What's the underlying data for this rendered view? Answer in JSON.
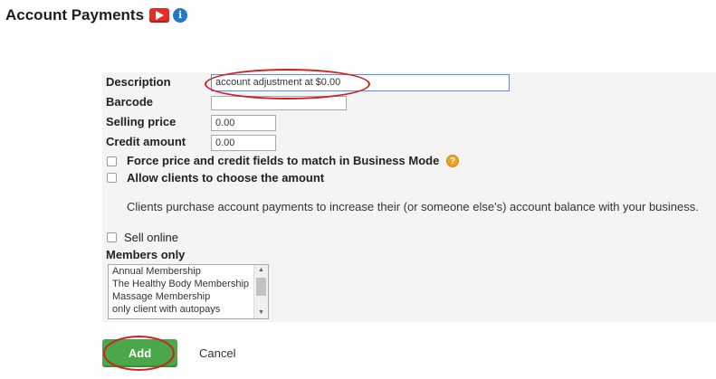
{
  "header": {
    "title": "Account Payments",
    "video_icon": "youtube-play-icon",
    "info_icon": "info-icon",
    "info_glyph": "i"
  },
  "form": {
    "description_label": "Description",
    "description_value": "account adjustment at $0.00",
    "barcode_label": "Barcode",
    "barcode_value": "",
    "selling_price_label": "Selling price",
    "selling_price_value": "0.00",
    "credit_amount_label": "Credit amount",
    "credit_amount_value": "0.00",
    "force_price_label": "Force price and credit fields to match in Business Mode",
    "help_glyph": "?",
    "allow_choose_label": "Allow clients to choose the amount",
    "info_text": "Clients purchase account payments to increase their (or someone else's) account balance with your business.",
    "sell_online_label": "Sell online",
    "members_only_label": "Members only",
    "memberships": [
      "Annual Membership",
      "The Healthy Body Membership",
      "Massage Membership",
      "only client with autopays"
    ],
    "scroll_up_glyph": "▲",
    "scroll_down_glyph": "▼"
  },
  "actions": {
    "add_label": "Add",
    "cancel_label": "Cancel"
  },
  "colors": {
    "add_button": "#4aa84a",
    "highlight": "#d41e1e",
    "info_icon": "#1f77d0",
    "video_icon": "#e52d27",
    "help_icon": "#f0a020"
  }
}
